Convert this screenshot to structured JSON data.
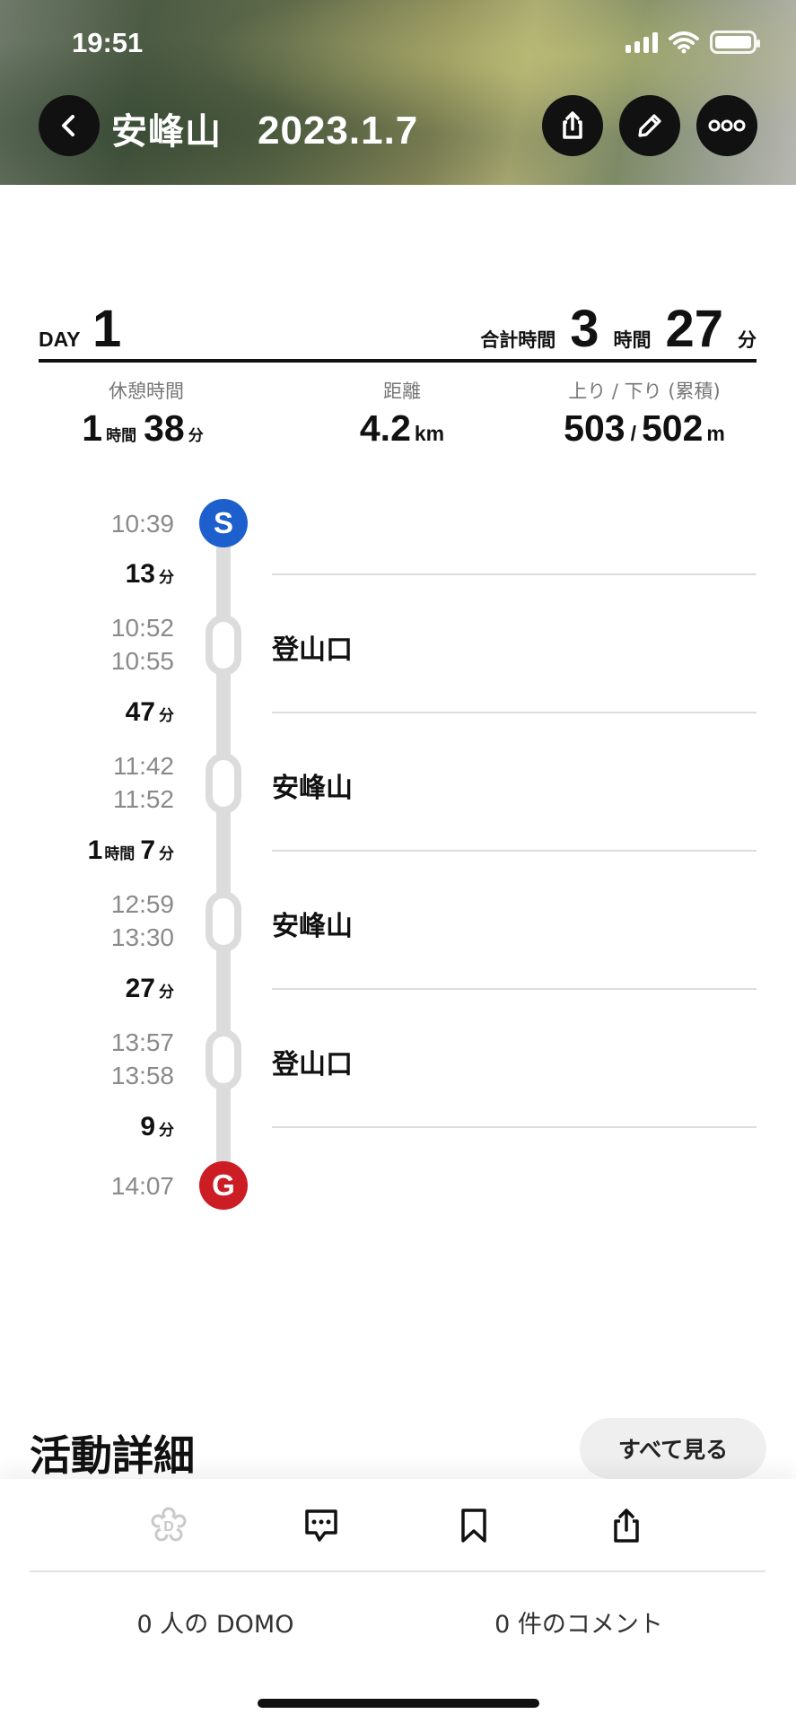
{
  "status_bar": {
    "time": "19:51"
  },
  "header": {
    "title": "安峰山",
    "date": "2023.1.7",
    "icons": [
      "back-icon",
      "share-icon",
      "edit-icon",
      "more-icon"
    ]
  },
  "day_summary": {
    "day_label": "DAY",
    "day_number": "1",
    "total_label": "合計時間",
    "total_hours": "3",
    "hours_unit": "時間",
    "total_minutes": "27",
    "minutes_unit": "分"
  },
  "stats": {
    "rest": {
      "label": "休憩時間",
      "hours": "1",
      "hours_unit": "時間",
      "minutes": "38",
      "minutes_unit": "分"
    },
    "distance": {
      "label": "距離",
      "value": "4.2",
      "unit": "km"
    },
    "elevation": {
      "label": "上り / 下り (累積)",
      "up": "503",
      "sep": "/",
      "down": "502",
      "unit": "m"
    }
  },
  "timeline": {
    "start": {
      "marker": "S",
      "time": "10:39"
    },
    "segments": [
      {
        "duration": "13",
        "unit": "分"
      },
      {
        "duration": "47",
        "unit": "分"
      },
      {
        "hours": "1",
        "hours_unit": "時間",
        "duration": "7",
        "unit": "分"
      },
      {
        "duration": "27",
        "unit": "分"
      },
      {
        "duration": "9",
        "unit": "分"
      }
    ],
    "stops": [
      {
        "arrive": "10:52",
        "depart": "10:55",
        "place": "登山口"
      },
      {
        "arrive": "11:42",
        "depart": "11:52",
        "place": "安峰山"
      },
      {
        "arrive": "12:59",
        "depart": "13:30",
        "place": "安峰山"
      },
      {
        "arrive": "13:57",
        "depart": "13:58",
        "place": "登山口"
      }
    ],
    "goal": {
      "marker": "G",
      "time": "14:07"
    }
  },
  "activity": {
    "title": "活動詳細",
    "see_all": "すべて見る"
  },
  "bottom_bar": {
    "actions": [
      "domo-icon",
      "comment-icon",
      "bookmark-icon",
      "share-icon"
    ],
    "domo_count": "0 人の DOMO",
    "comment_count": "0 件のコメント"
  },
  "colors": {
    "start": "#1d5fcc",
    "goal": "#cc1c24",
    "rail": "#dcdcdc"
  }
}
